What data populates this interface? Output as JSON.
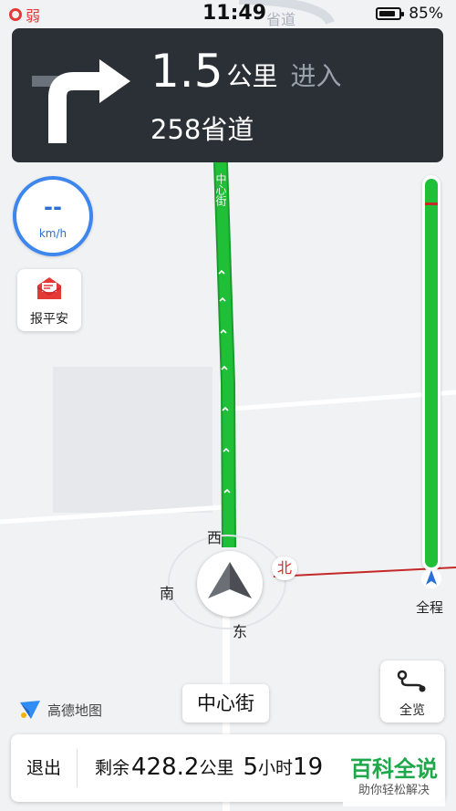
{
  "status_bar": {
    "signal_label": "弱",
    "time": "11:49",
    "battery_text": "85%",
    "battery_level": 0.85
  },
  "nav": {
    "distance_value": "1.5",
    "distance_unit": "公里",
    "action": "进入",
    "next_road": "258省道",
    "turn_icon": "turn-right-arrow"
  },
  "map": {
    "background_road_label": "省道",
    "vertical_road_label": "中心街"
  },
  "speed": {
    "value": "--",
    "unit": "km/h"
  },
  "report_safe": {
    "label": "报平安",
    "icon": "envelope-icon"
  },
  "progress": {
    "label": "全程",
    "completed_fraction": 0.0,
    "icon": "navigation-arrow"
  },
  "compass": {
    "north": "北",
    "south": "南",
    "east": "东",
    "west": "西"
  },
  "overview": {
    "label": "全览",
    "icon": "route-icon"
  },
  "brand": {
    "name": "高德地图"
  },
  "current_road": "中心街",
  "bottom_bar": {
    "exit_label": "退出",
    "remaining_label": "剩余",
    "remaining_distance": "428.2",
    "remaining_distance_unit": "公里",
    "remaining_time_value": "5",
    "remaining_time_unit": "小时",
    "remaining_minutes_partial": "19"
  },
  "watermark": {
    "title": "百科全说",
    "subtitle": "助你轻松解决"
  },
  "colors": {
    "route_green": "#1fbf38",
    "nav_card_bg": "#2b2f36",
    "accent_blue": "#3d86ee",
    "alert_red": "#d42828"
  }
}
